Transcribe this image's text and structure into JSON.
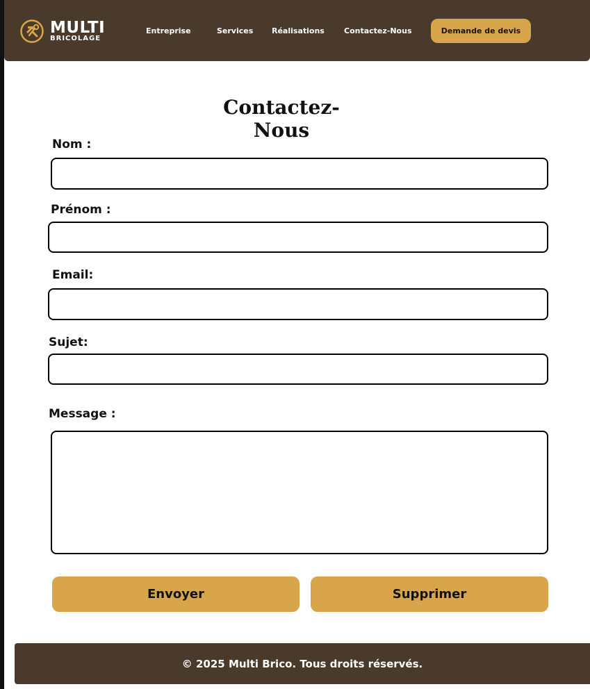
{
  "brand": {
    "name": "MULTI",
    "subtitle": "BRICOLAGE",
    "icon": "hammer-wrench-icon",
    "color": "#4a3a2b",
    "accent": "#d9a54a"
  },
  "nav": {
    "items": [
      "Entreprise",
      "Services",
      "Réalisations",
      "Contactez-Nous"
    ],
    "cta": "Demande de devis"
  },
  "form": {
    "title": "Contactez-Nous",
    "labels": {
      "nom": "Nom :",
      "prenom": "Prénom :",
      "email": "Email:",
      "sujet": "Sujet:",
      "message": "Message :"
    },
    "values": {
      "nom": "",
      "prenom": "",
      "email": "",
      "sujet": "",
      "message": ""
    },
    "buttons": {
      "submit": "Envoyer",
      "delete": "Supprimer"
    }
  },
  "footer": {
    "text": "© 2025 Multi Brico. Tous droits réservés."
  }
}
